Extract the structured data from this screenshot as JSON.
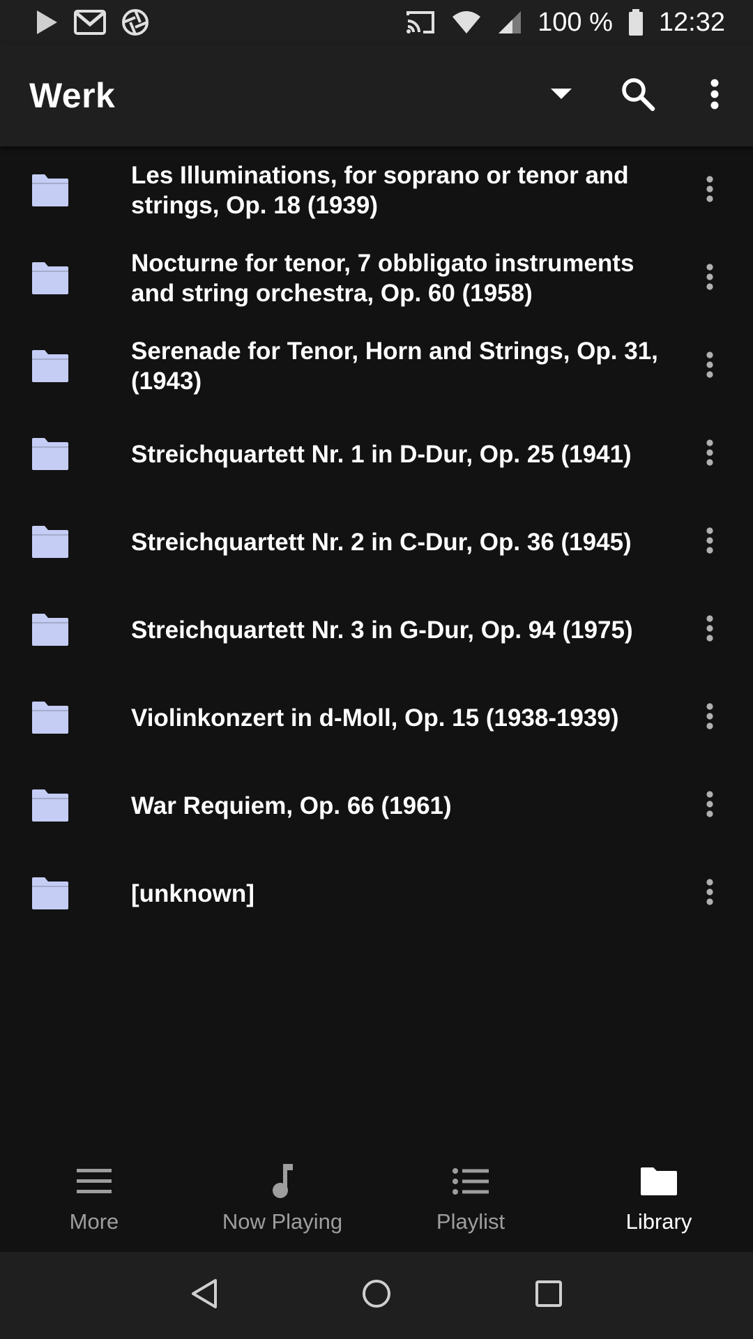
{
  "status_bar": {
    "battery": "100 %",
    "time": "12:32",
    "left_icons": [
      "play-store-icon",
      "gmail-icon",
      "aperture-icon"
    ],
    "right_icons": [
      "cast-icon",
      "wifi-icon",
      "signal-icon",
      "battery-icon"
    ]
  },
  "app_bar": {
    "title": "Werk",
    "actions": [
      "dropdown-arrow-icon",
      "search-icon",
      "overflow-menu-icon"
    ]
  },
  "list": {
    "items": [
      {
        "label": "Les Illuminations, for soprano or tenor and strings, Op. 18 (1939)"
      },
      {
        "label": "Nocturne for tenor, 7 obbligato instruments and string orchestra, Op. 60 (1958)"
      },
      {
        "label": "Serenade for Tenor, Horn and Strings, Op. 31, (1943)"
      },
      {
        "label": "Streichquartett Nr. 1 in D-Dur, Op. 25 (1941)"
      },
      {
        "label": "Streichquartett Nr. 2 in C-Dur, Op. 36 (1945)"
      },
      {
        "label": "Streichquartett Nr. 3 in G-Dur, Op. 94 (1975)"
      },
      {
        "label": "Violinkonzert in d-Moll, Op. 15 (1938-1939)"
      },
      {
        "label": "War Requiem, Op. 66 (1961)"
      },
      {
        "label": "[unknown]"
      }
    ]
  },
  "bottom_nav": {
    "items": [
      {
        "label": "More",
        "icon": "menu-icon"
      },
      {
        "label": "Now Playing",
        "icon": "music-note-icon"
      },
      {
        "label": "Playlist",
        "icon": "list-icon"
      },
      {
        "label": "Library",
        "icon": "folder-icon",
        "active": true
      }
    ]
  },
  "colors": {
    "background": "#121212",
    "bar": "#1f1f1f",
    "folder": "#c5cdf5",
    "inactive": "#9e9e9e",
    "text": "#ffffff"
  }
}
